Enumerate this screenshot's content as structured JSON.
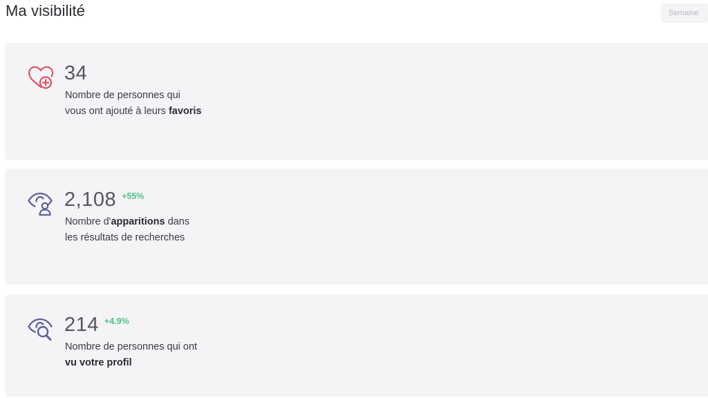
{
  "header": {
    "title": "Ma visibilité",
    "period_button": "Semaine"
  },
  "cards": [
    {
      "icon": "heart-plus-icon",
      "value": "34",
      "change": "",
      "desc_pre": "Nombre de personnes qui vous ont ajouté à leurs ",
      "desc_bold": "favoris",
      "desc_post": ""
    },
    {
      "icon": "eye-user-icon",
      "value": "2,108",
      "change": "+55%",
      "desc_pre": "Nombre d'",
      "desc_bold": "apparitions",
      "desc_post": " dans les résultats de recherches"
    },
    {
      "icon": "eye-search-icon",
      "value": "214",
      "change": "+4.9%",
      "desc_pre": "Nombre de personnes qui ont ",
      "desc_bold": "vu votre profil",
      "desc_post": ""
    }
  ],
  "colors": {
    "heart_icon": "#e0506a",
    "eye_icon": "#5a5e9c",
    "positive_change": "#4cc38a",
    "card_background": "#f4f4f6"
  }
}
